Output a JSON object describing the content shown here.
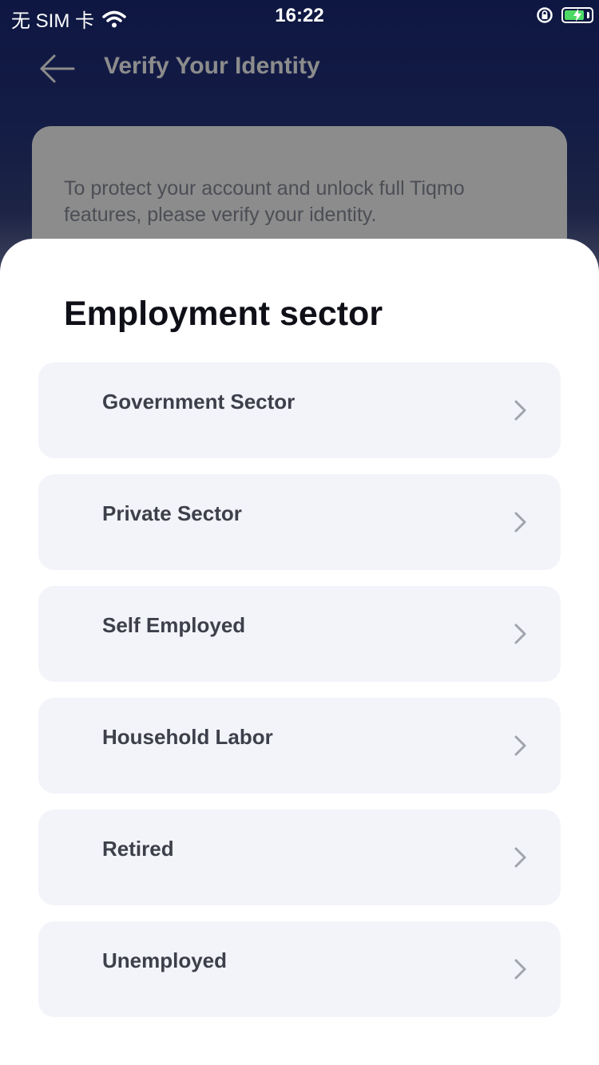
{
  "status_bar": {
    "carrier": "无 SIM 卡",
    "time": "16:22",
    "battery_level": 0.75
  },
  "background": {
    "title": "Verify Your Identity",
    "description": "To protect your account and unlock full Tiqmo features, please verify your identity."
  },
  "sheet": {
    "title": "Employment sector",
    "options": [
      {
        "label": "Government Sector"
      },
      {
        "label": "Private Sector"
      },
      {
        "label": "Self Employed"
      },
      {
        "label": "Household Labor"
      },
      {
        "label": "Retired"
      },
      {
        "label": "Unemployed"
      }
    ]
  },
  "colors": {
    "header_blue": "#1b2a78",
    "option_bg": "#f3f4f9",
    "title_text": "#0f1017",
    "option_text": "#3d3f4a",
    "chevron": "#a0a4ae",
    "battery_green": "#4cd964"
  }
}
